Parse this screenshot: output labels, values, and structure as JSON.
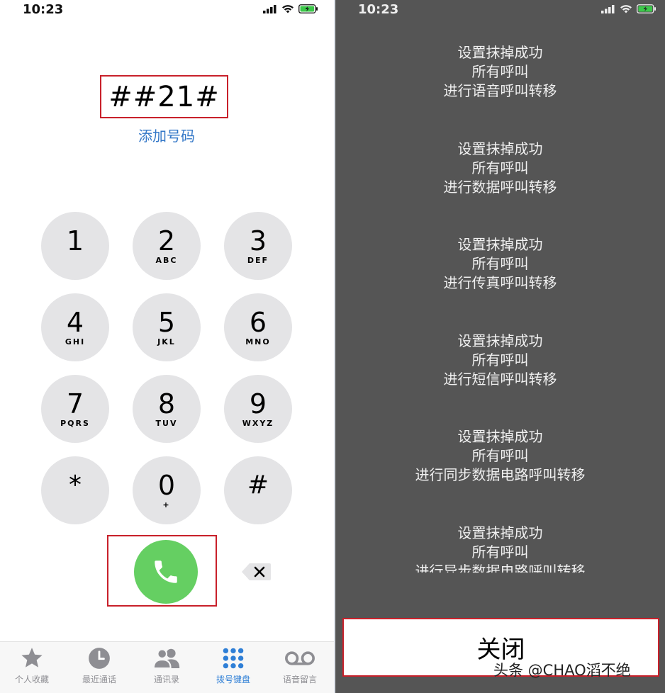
{
  "left_phone": {
    "status_bar": {
      "time": "10:23"
    },
    "dialed_number": "##21#",
    "add_number_label": "添加号码",
    "keypad": [
      {
        "digit": "1",
        "letters": ""
      },
      {
        "digit": "2",
        "letters": "ABC"
      },
      {
        "digit": "3",
        "letters": "DEF"
      },
      {
        "digit": "4",
        "letters": "GHI"
      },
      {
        "digit": "5",
        "letters": "JKL"
      },
      {
        "digit": "6",
        "letters": "MNO"
      },
      {
        "digit": "7",
        "letters": "PQRS"
      },
      {
        "digit": "8",
        "letters": "TUV"
      },
      {
        "digit": "9",
        "letters": "WXYZ"
      },
      {
        "digit": "*",
        "letters": ""
      },
      {
        "digit": "0",
        "letters": "+"
      },
      {
        "digit": "#",
        "letters": ""
      }
    ],
    "tab_bar": [
      {
        "label": "个人收藏",
        "icon": "star-icon",
        "active": false
      },
      {
        "label": "最近通话",
        "icon": "clock-icon",
        "active": false
      },
      {
        "label": "通讯录",
        "icon": "contacts-icon",
        "active": false
      },
      {
        "label": "拨号键盘",
        "icon": "keypad-icon",
        "active": true
      },
      {
        "label": "语音留言",
        "icon": "voicemail-icon",
        "active": false
      }
    ],
    "colors": {
      "call_green": "#65cf62",
      "active_blue": "#2f7fd6",
      "highlight_red": "#c8202a"
    }
  },
  "right_phone": {
    "status_bar": {
      "time": "10:23"
    },
    "messages": [
      {
        "line1": "设置抹掉成功",
        "line2": "所有呼叫",
        "line3": "进行语音呼叫转移"
      },
      {
        "line1": "设置抹掉成功",
        "line2": "所有呼叫",
        "line3": "进行数据呼叫转移"
      },
      {
        "line1": "设置抹掉成功",
        "line2": "所有呼叫",
        "line3": "进行传真呼叫转移"
      },
      {
        "line1": "设置抹掉成功",
        "line2": "所有呼叫",
        "line3": "进行短信呼叫转移"
      },
      {
        "line1": "设置抹掉成功",
        "line2": "所有呼叫",
        "line3": "进行同步数据电路呼叫转移"
      },
      {
        "line1": "设置抹掉成功",
        "line2": "所有呼叫",
        "line3": "进行异步数据电路呼叫转移"
      }
    ],
    "close_button": "关闭",
    "watermark": "头条 @CHAO滔不绝"
  }
}
